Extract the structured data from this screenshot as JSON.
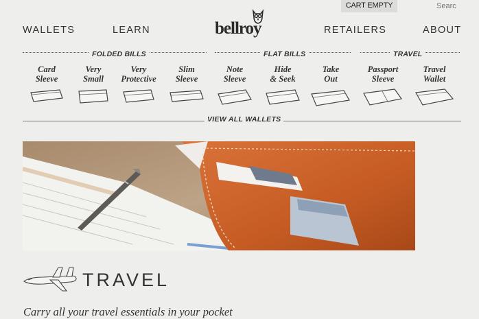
{
  "header": {
    "cart_label": "CART EMPTY",
    "search_placeholder": "Searc",
    "logo_text": "bellroy",
    "nav": {
      "wallets": "WALLETS",
      "learn": "LEARN",
      "retailers": "RETAILERS",
      "about": "ABOUT"
    }
  },
  "categories": [
    {
      "label": "FOLDED BILLS",
      "wallets": [
        "Card\nSleeve",
        "Very\nSmall",
        "Very\nProtective",
        "Slim\nSleeve"
      ]
    },
    {
      "label": "FLAT BILLS",
      "wallets": [
        "Note\nSleeve",
        "Hide\n& Seek",
        "Take\nOut"
      ]
    },
    {
      "label": "TRAVEL",
      "wallets": [
        "Passport\nSleeve",
        "Travel\nWallet"
      ]
    }
  ],
  "wallets": {
    "card_sleeve": "Card\nSleeve",
    "very_small": "Very\nSmall",
    "very_protective": "Very\nProtective",
    "slim_sleeve": "Slim\nSleeve",
    "note_sleeve": "Note\nSleeve",
    "hide_seek": "Hide\n& Seek",
    "take_out": "Take\nOut",
    "passport_sleeve": "Passport\nSleeve",
    "travel_wallet": "Travel\nWallet"
  },
  "category_labels": {
    "folded": "FOLDED BILLS",
    "flat": "FLAT BILLS",
    "travel": "TRAVEL"
  },
  "view_all": "VIEW ALL WALLETS",
  "section": {
    "heading": "TRAVEL",
    "tagline": "Carry all your travel essentials in your pocket",
    "icon": "airplane-icon"
  },
  "colors": {
    "background": "#eeeeec",
    "leather": "#c8602a",
    "text": "#333333"
  }
}
